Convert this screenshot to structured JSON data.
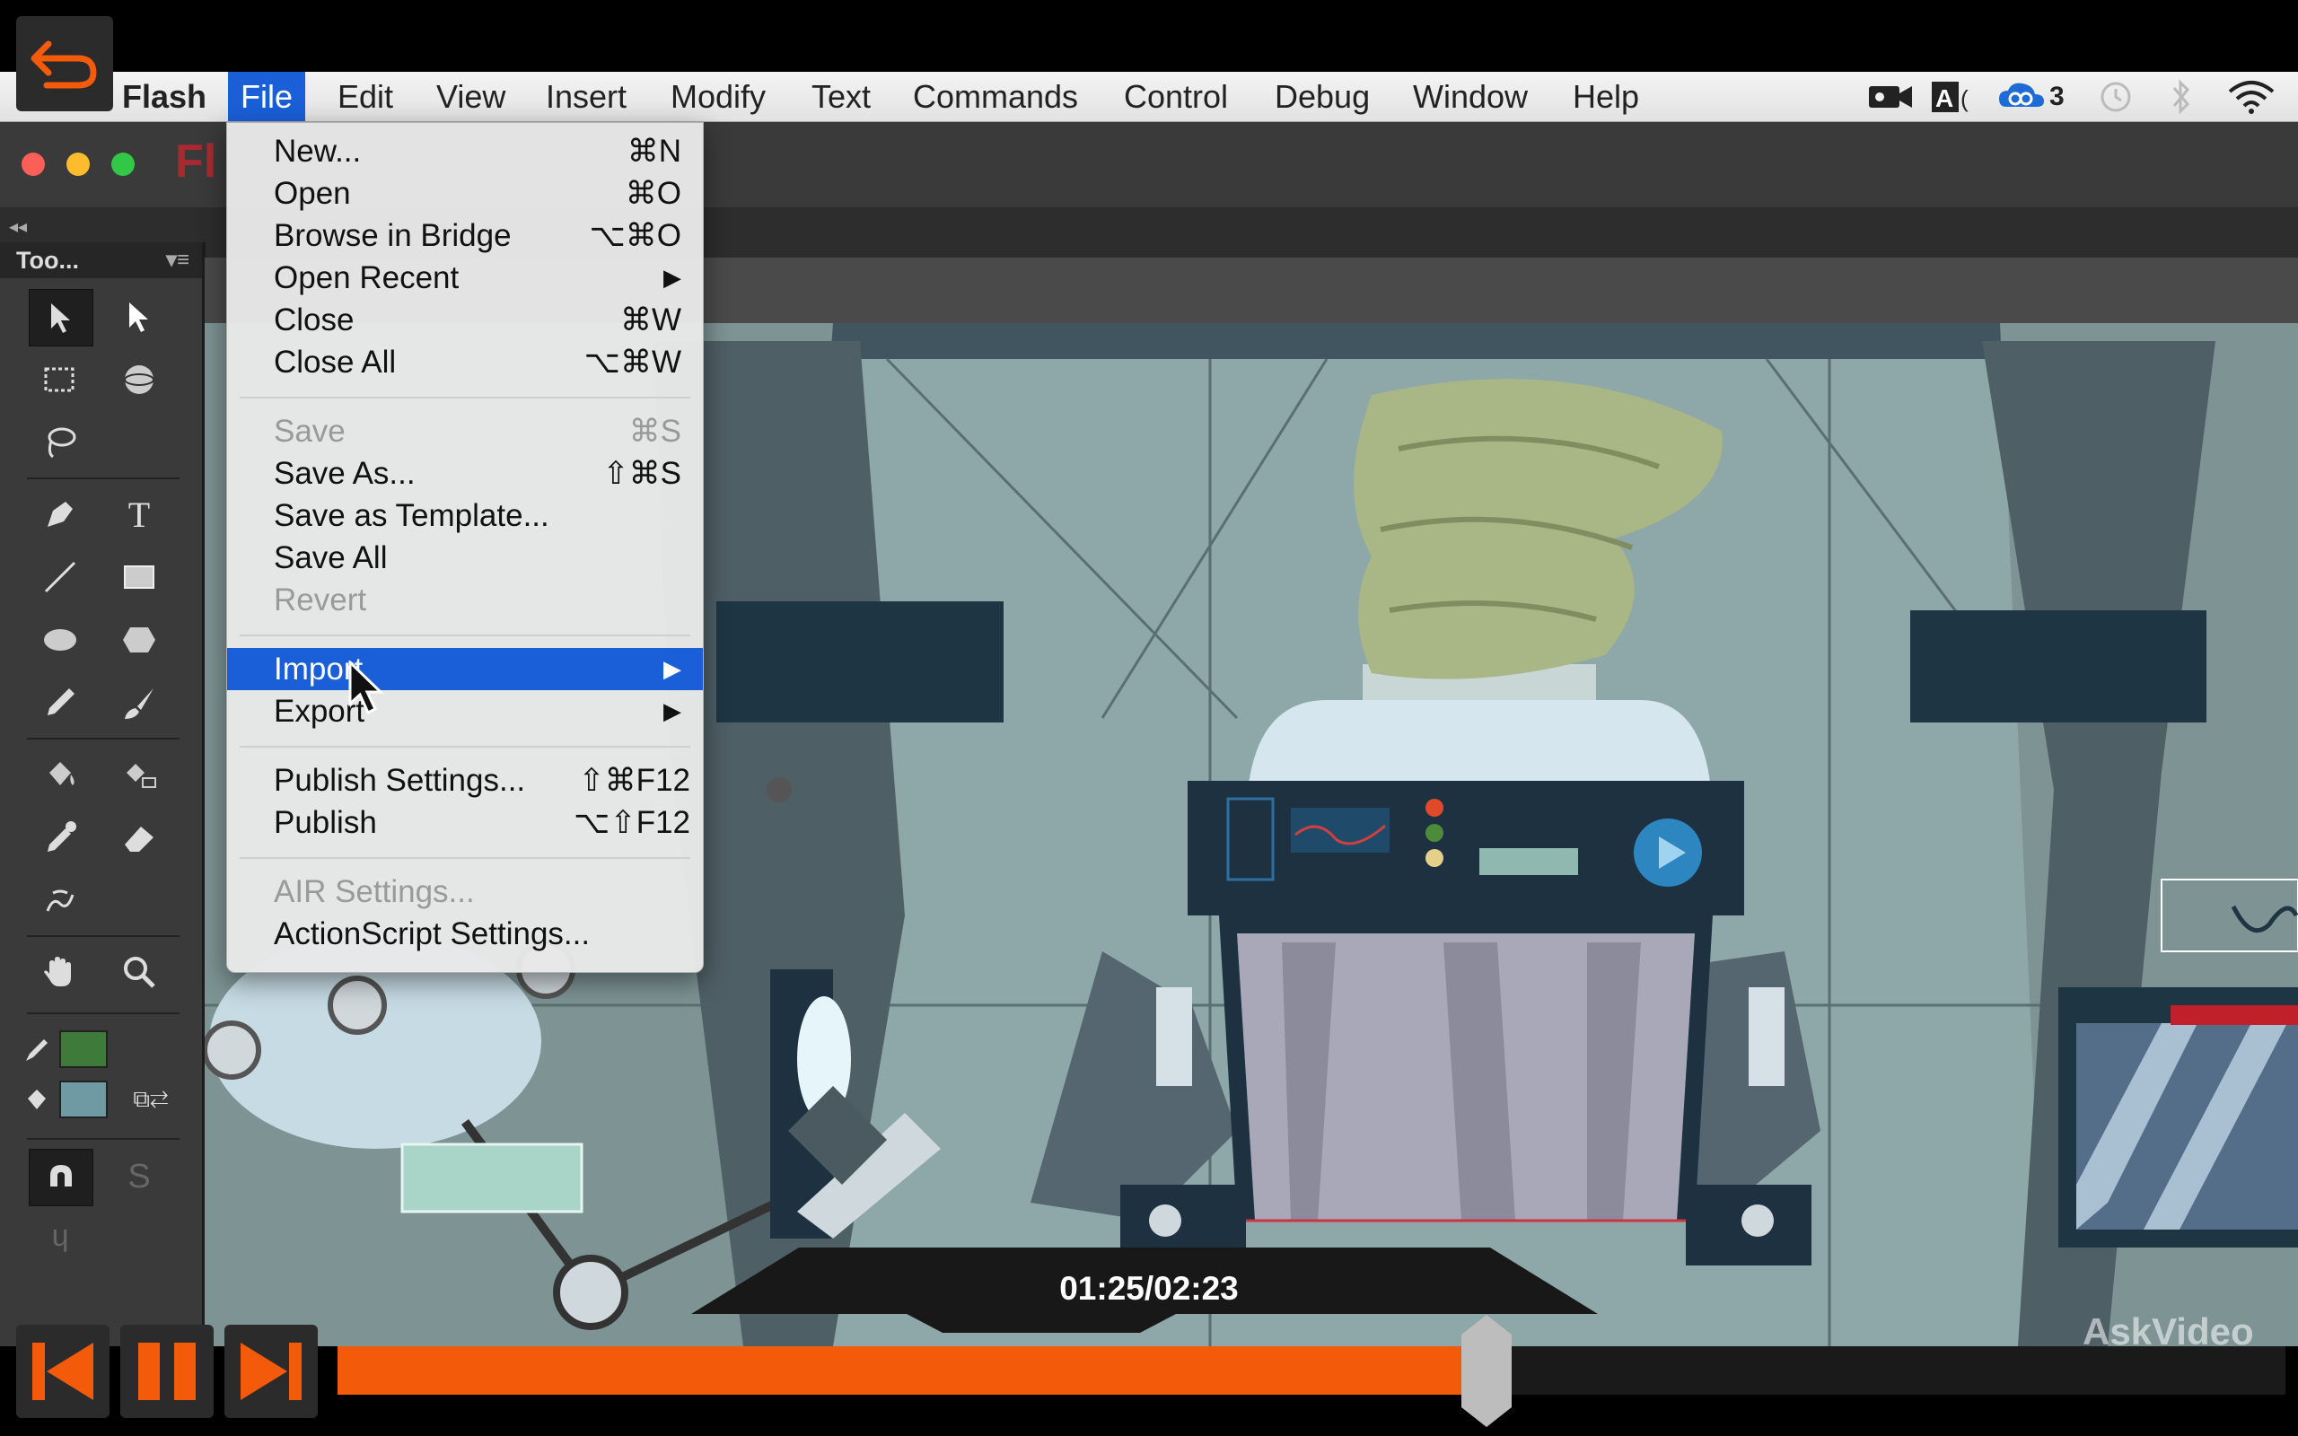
{
  "menubar": {
    "app": "Flash",
    "items": [
      "File",
      "Edit",
      "View",
      "Insert",
      "Modify",
      "Text",
      "Commands",
      "Control",
      "Debug",
      "Window",
      "Help"
    ],
    "tray_cc_count": "3"
  },
  "window": {
    "title_partial": "Fl"
  },
  "tools_panel": {
    "title": "Too...",
    "stroke_color": "#3e7a3a",
    "fill_color": "#6f9aa4"
  },
  "file_menu": {
    "items": [
      {
        "label": "New...",
        "shortcut": "⌘N"
      },
      {
        "label": "Open",
        "shortcut": "⌘O"
      },
      {
        "label": "Browse in Bridge",
        "shortcut": "⌥⌘O"
      },
      {
        "label": "Open Recent",
        "shortcut": "▶"
      },
      {
        "label": "Close",
        "shortcut": "⌘W"
      },
      {
        "label": "Close All",
        "shortcut": "⌥⌘W"
      },
      {
        "label": "Save",
        "shortcut": "⌘S"
      },
      {
        "label": "Save As...",
        "shortcut": "⇧⌘S"
      },
      {
        "label": "Save as Template...",
        "shortcut": ""
      },
      {
        "label": "Save All",
        "shortcut": ""
      },
      {
        "label": "Revert",
        "shortcut": ""
      },
      {
        "label": "Import",
        "shortcut": "▶"
      },
      {
        "label": "Export",
        "shortcut": "▶"
      },
      {
        "label": "Publish Settings...",
        "shortcut": "⇧⌘F12"
      },
      {
        "label": "Publish",
        "shortcut": "⌥⇧F12"
      },
      {
        "label": "AIR Settings...",
        "shortcut": ""
      },
      {
        "label": "ActionScript Settings...",
        "shortcut": ""
      }
    ]
  },
  "player": {
    "timecode": "01:25/02:23",
    "progress": 0.59,
    "watermark": "AskVideo",
    "accent": "#f35a0a"
  }
}
